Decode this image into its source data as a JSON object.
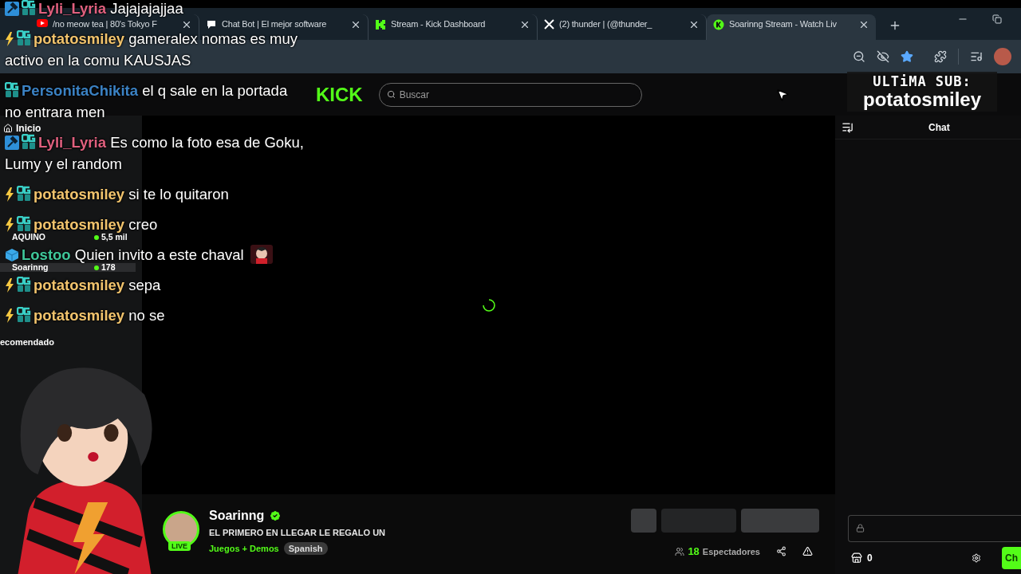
{
  "browser": {
    "tabs": [
      {
        "title": "/no meow tea | 80's Tokyo F",
        "kind": "video",
        "selected": false
      },
      {
        "title": "Chat Bot | El mejor software",
        "kind": "bot",
        "selected": false
      },
      {
        "title": "Stream - Kick Dashboard",
        "kind": "kick",
        "selected": false
      },
      {
        "title": "(2) thunder | (@thunder_",
        "kind": "x",
        "selected": false
      },
      {
        "title": "Soarinng Stream - Watch Liv",
        "kind": "kick-round",
        "selected": true
      }
    ]
  },
  "page": {
    "logo": "KICK",
    "search": {
      "placeholder": "Buscar"
    },
    "sidebar": {
      "nav": [
        {
          "label": "Inicio"
        }
      ],
      "channels": [
        {
          "name": "AQUINO",
          "viewers": "5,5 mil",
          "selected": false
        },
        {
          "name": "Soarinng",
          "viewers": "178",
          "selected": true
        }
      ],
      "section": "ecomendado"
    },
    "stream": {
      "name": "Soarinng",
      "live": "LIVE",
      "title": "EL PRIMERO EN LLEGAR LE REGALO UN",
      "category": "Juegos + Demos",
      "language": "Spanish",
      "viewers": "18",
      "viewers_label": "Espectadores"
    },
    "chat": {
      "title": "Chat",
      "points": "0",
      "send": "Ch"
    }
  },
  "overlay_chat": {
    "messages": [
      {
        "user": "Lyli_Lyria",
        "color": "#e0607e",
        "badges": [
          {
            "kind": "mod"
          },
          {
            "kind": "og"
          }
        ],
        "text": "Jajajajajjaa",
        "emote": false
      },
      {
        "user": "potatosmiley",
        "color": "#f2c46d",
        "badges": [
          {
            "kind": "bolt"
          },
          {
            "kind": "og"
          }
        ],
        "text": "gameralex nomas es muy activo en la comu KAUSJAS",
        "emote": false
      },
      {
        "user": "PersonitaChikita",
        "color": "#3b82c4",
        "badges": [
          {
            "kind": "og"
          }
        ],
        "text": "el q sale en la portada no entrara men",
        "emote": false
      },
      {
        "user": "Lyli_Lyria",
        "color": "#e0607e",
        "badges": [
          {
            "kind": "mod"
          },
          {
            "kind": "og"
          }
        ],
        "text": "Es como la foto esa de Goku, Lumy y el random",
        "emote": false
      },
      {
        "user": "potatosmiley",
        "color": "#f2c46d",
        "badges": [
          {
            "kind": "bolt"
          },
          {
            "kind": "og"
          }
        ],
        "text": "si te lo quitaron",
        "emote": false
      },
      {
        "user": "potatosmiley",
        "color": "#f2c46d",
        "badges": [
          {
            "kind": "bolt"
          },
          {
            "kind": "og"
          }
        ],
        "text": "creo",
        "emote": false
      },
      {
        "user": "Lostoo",
        "color": "#3fc79a",
        "badges": [
          {
            "kind": "cube"
          }
        ],
        "text": "Quien invito a este chaval",
        "emote": true
      },
      {
        "user": "potatosmiley",
        "color": "#f2c46d",
        "badges": [
          {
            "kind": "bolt"
          },
          {
            "kind": "og"
          }
        ],
        "text": "sepa",
        "emote": false
      },
      {
        "user": "potatosmiley",
        "color": "#f2c46d",
        "badges": [
          {
            "kind": "bolt"
          },
          {
            "kind": "og"
          }
        ],
        "text": "no se",
        "emote": false
      }
    ]
  },
  "sub_alert": {
    "heading": "ULTiMA SUB:",
    "name": "potatosmiley"
  }
}
